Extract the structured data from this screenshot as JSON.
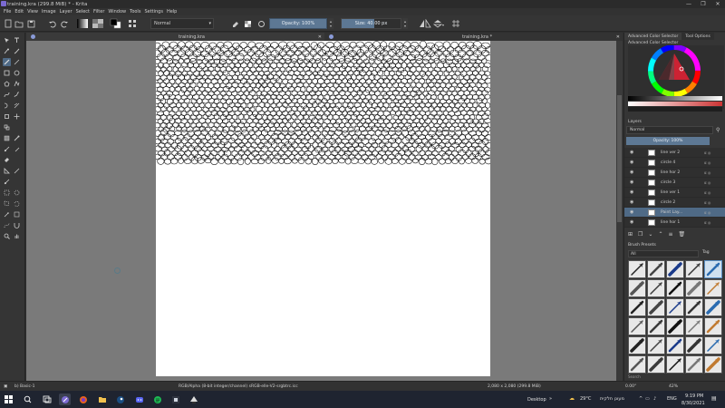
{
  "window": {
    "title": "training.kra (299.8 MiB)  * - Krita",
    "controls": [
      "—",
      "❐",
      "✕"
    ]
  },
  "menu": [
    "File",
    "Edit",
    "View",
    "Image",
    "Layer",
    "Select",
    "Filter",
    "Window",
    "Tools",
    "Settings",
    "Help"
  ],
  "toolbar": {
    "blend_mode": "Normal",
    "opacity_label": "Opacity: 100%",
    "opacity_fraction": 1.0,
    "size_label": "Size: 40.00 px",
    "size_fraction": 0.55
  },
  "tabs": [
    {
      "label": "training.kra",
      "active": true
    },
    {
      "label": "training.kra *",
      "active": false
    }
  ],
  "docker": {
    "tabs": [
      "Advanced Color Selector",
      "Tool Options"
    ],
    "color_selector_title": "Advanced Color Selector",
    "layers_title": "Layers",
    "layer_blend": "Normal",
    "layer_opacity": "Opacity:  100%",
    "layers": [
      {
        "name": "line ver 2",
        "selected": false
      },
      {
        "name": "circle 4",
        "selected": false
      },
      {
        "name": "line hor 2",
        "selected": false
      },
      {
        "name": "circle 3",
        "selected": false
      },
      {
        "name": "line ver 1",
        "selected": false
      },
      {
        "name": "circle 2",
        "selected": false
      },
      {
        "name": "Paint Lay...",
        "selected": true
      },
      {
        "name": "line hor 1",
        "selected": false
      }
    ],
    "layer_flags": "α ◎",
    "presets_title": "Brush Presets",
    "preset_filter": "All",
    "preset_tag": "Tag",
    "preset_search": "Search"
  },
  "status": {
    "brush": "b) Basic-1",
    "color_space": "RGB/Alpha (8-bit integer/channel)  sRGB-elle-V2-srgbtrc.icc",
    "dimensions": "2,080 x 2,080 (299.8 MiB)",
    "rotation": "0.00°",
    "zoom": "42%"
  },
  "taskbar": {
    "desktop": "Desktop",
    "weather": "29°C",
    "weather_text": "מעונן חלקית",
    "lang": "ENG",
    "time": "9:19 PM",
    "date": "8/30/2021"
  }
}
